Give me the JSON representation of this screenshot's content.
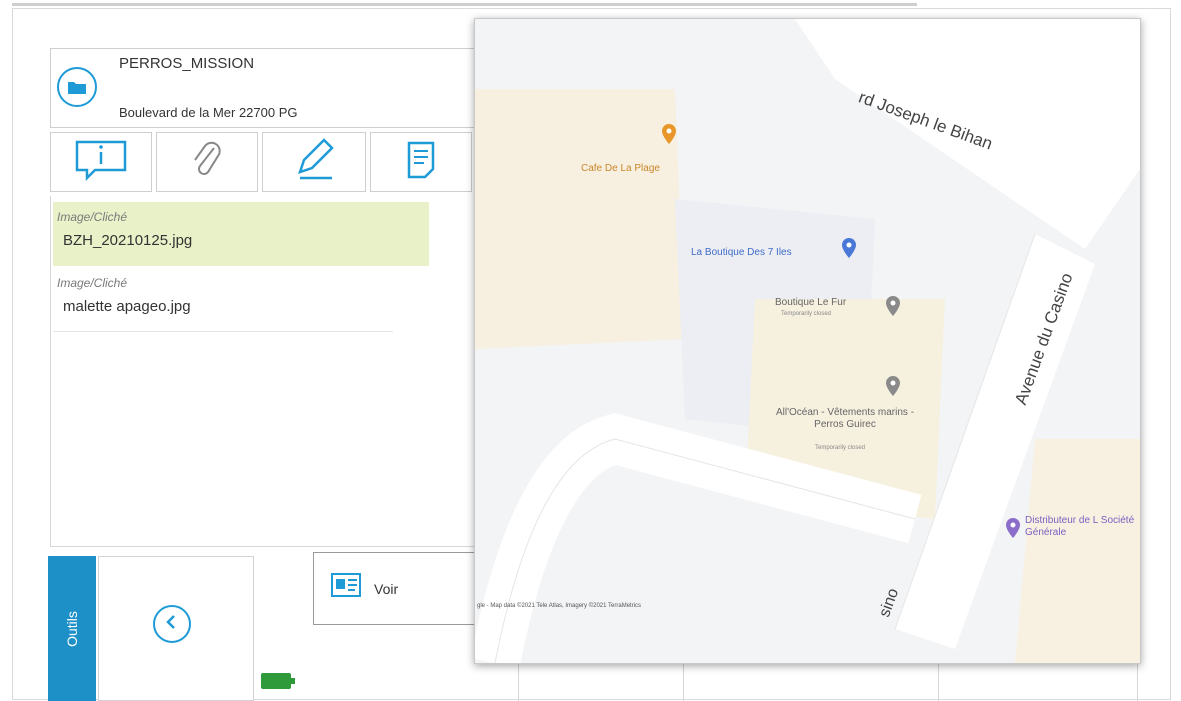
{
  "mission": {
    "title": "PERROS_MISSION",
    "address": "Boulevard de la Mer 22700 PG"
  },
  "toolbar": {
    "buttons": [
      {
        "icon": "info-icon"
      },
      {
        "icon": "paperclip-icon"
      },
      {
        "icon": "pencil-icon"
      },
      {
        "icon": "document-icon"
      }
    ]
  },
  "attachments": [
    {
      "kind": "Image/Cliché",
      "file": "BZH_20210125.jpg",
      "selected": true
    },
    {
      "kind": "Image/Cliché",
      "file": "malette apageo.jpg",
      "selected": false
    }
  ],
  "bottom": {
    "tab_label": "Outils",
    "view_label": "Voir"
  },
  "map": {
    "streets": [
      {
        "name": "rd Joseph le Bihan"
      },
      {
        "name": "Avenue du Casino"
      },
      {
        "name": "sino"
      }
    ],
    "places": [
      {
        "name": "Cafe De La Plage",
        "color": "#e8962a"
      },
      {
        "name": "La Boutique Des 7 Iles",
        "color": "#4b78d6"
      },
      {
        "name": "Boutique Le Fur",
        "note": "Temporarily closed",
        "color": "#8a8a8a"
      },
      {
        "name": "All'Océan - Vêtements marins - Perros Guirec",
        "note": "Temporarily closed",
        "color": "#8a8a8a"
      },
      {
        "name": "Distributeur de L Société Générale",
        "color": "#8b6ec9"
      }
    ],
    "attribution": "gle - Map data ©2021 Tele Atlas, Imagery ©2021 TerraMetrics"
  },
  "colors": {
    "accent": "#1e9ad6",
    "selected_row": "#e9f1c8",
    "battery": "#2e9a3a"
  }
}
